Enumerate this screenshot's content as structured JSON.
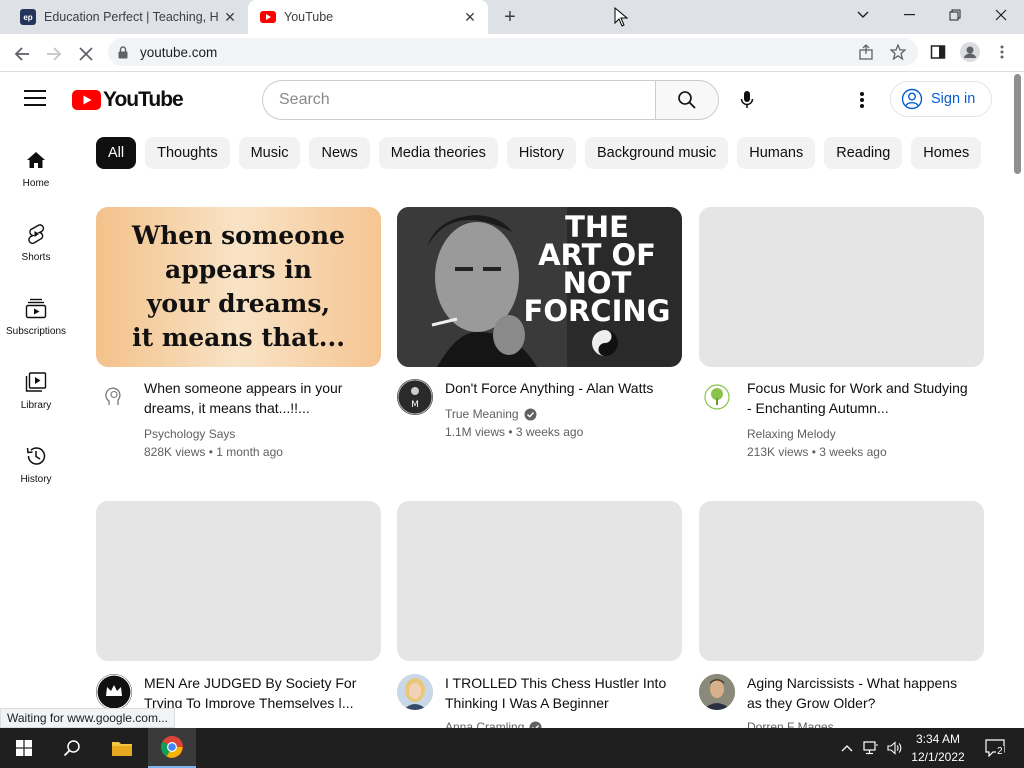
{
  "browser": {
    "tabs": [
      {
        "title": "Education Perfect | Teaching, Homework and Revision Software",
        "favicon": "ep"
      },
      {
        "title": "YouTube",
        "favicon": "youtube-icon"
      }
    ],
    "url": "youtube.com",
    "status": "Waiting for www.google.com..."
  },
  "youtube": {
    "logo_text": "YouTube",
    "search_placeholder": "Search",
    "sign_in": "Sign in",
    "sidebar": [
      {
        "label": "Home",
        "icon": "home-icon"
      },
      {
        "label": "Shorts",
        "icon": "shorts-icon"
      },
      {
        "label": "Subscriptions",
        "icon": "subscriptions-icon"
      },
      {
        "label": "Library",
        "icon": "library-icon"
      },
      {
        "label": "History",
        "icon": "history-icon"
      }
    ],
    "chips": [
      "All",
      "Thoughts",
      "Music",
      "News",
      "Media theories",
      "History",
      "Background music",
      "Humans",
      "Reading",
      "Homes"
    ],
    "videos": [
      {
        "title": "When someone appears in your dreams, it means that...!!...",
        "channel": "Psychology Says",
        "meta": "828K views • 1 month ago",
        "thumb_text": "When someone appears in your dreams, it means that...",
        "verified": false
      },
      {
        "title": "Don't Force Anything - Alan Watts",
        "channel": "True Meaning",
        "meta": "1.1M views • 3 weeks ago",
        "thumb_text": "THE ART OF NOT FORCING",
        "verified": true
      },
      {
        "title": "Focus Music for Work and Studying - Enchanting Autumn...",
        "channel": "Relaxing Melody",
        "meta": "213K views • 3 weeks ago",
        "verified": false
      },
      {
        "title": "MEN Are JUDGED By Society For Trying To Improve Themselves |...",
        "channel": "",
        "meta": "",
        "verified": false
      },
      {
        "title": "I TROLLED This Chess Hustler Into Thinking I Was A Beginner",
        "channel": "Anna Cramling",
        "meta": "",
        "verified": true
      },
      {
        "title": "Aging Narcissists - What happens as they Grow Older?",
        "channel": "Dorren F Mages",
        "meta": "",
        "verified": false
      }
    ]
  },
  "taskbar": {
    "time": "3:34 AM",
    "date": "12/1/2022",
    "notification_count": "2"
  },
  "colors": {
    "yt_red": "#ff0000",
    "link_blue": "#065fd4",
    "chip_bg": "#f2f2f2",
    "taskbar_bg": "#1f1f1f"
  }
}
